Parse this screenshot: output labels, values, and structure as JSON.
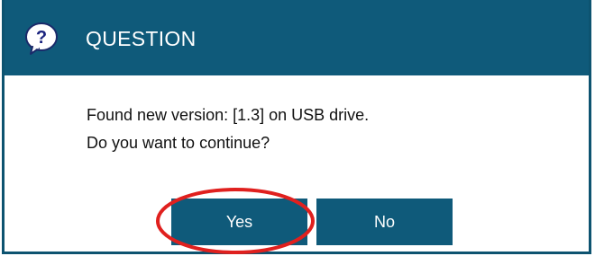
{
  "dialog": {
    "title": "QUESTION",
    "message_line1": "Found new version: [1.3] on USB drive.",
    "message_line2": "Do you want to continue?",
    "yes_label": "Yes",
    "no_label": "No",
    "icon": "question-bubble-icon"
  },
  "colors": {
    "titlebar": "#0f5a7a",
    "button": "#0f5a7a",
    "highlight_annotation": "#e0201e"
  }
}
